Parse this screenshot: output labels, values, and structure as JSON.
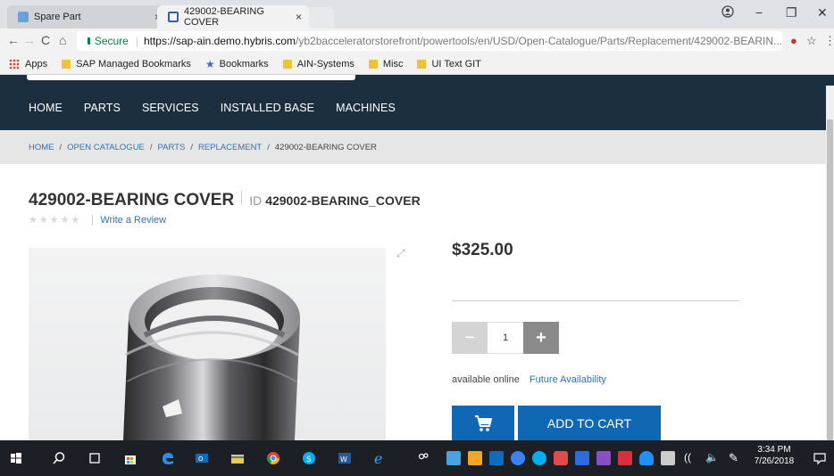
{
  "browser": {
    "tabs": [
      {
        "title": "Spare Part",
        "close": "×"
      },
      {
        "title": "429002-BEARING COVER",
        "close": "×"
      }
    ],
    "window_controls": {
      "minimize": "−",
      "maximize": "❐",
      "close": "✕"
    },
    "nav": {
      "back": "←",
      "forward": "→",
      "reload": "C",
      "home": "⌂"
    },
    "address": {
      "secure_label": "Secure",
      "url_domain": "https://sap-ain.demo.hybris.com",
      "url_path": "/yb2bacceleratorstorefront/powertools/en/USD/Open-Catalogue/Parts/Replacement/429002-BEARIN..."
    },
    "bookmarks": [
      "Apps",
      "SAP Managed Bookmarks",
      "Bookmarks",
      "AIN-Systems",
      "Misc",
      "UI Text GIT"
    ]
  },
  "site": {
    "nav": [
      "HOME",
      "PARTS",
      "SERVICES",
      "INSTALLED BASE",
      "MACHINES"
    ],
    "breadcrumb": {
      "items": [
        "HOME",
        "OPEN CATALOGUE",
        "PARTS",
        "REPLACEMENT"
      ],
      "current": "429002-BEARING COVER",
      "separator": "/"
    },
    "product": {
      "name": "429002-BEARING COVER",
      "id_label": "ID",
      "id_value": "429002-BEARING_COVER",
      "stars": "★★★★★",
      "review_link": "Write a Review",
      "price": "$325.00",
      "qty_minus": "−",
      "qty_value": "1",
      "qty_plus": "+",
      "availability": "available online",
      "future_link": "Future Availability",
      "add_to_cart": "ADD TO CART"
    }
  },
  "taskbar": {
    "time": "3:34 PM",
    "date": "7/26/2018"
  },
  "colors": {
    "nav_bg": "#1c2f3f",
    "link": "#2d72b8",
    "cart_blue": "#1068b5",
    "breadcrumb_bg": "#e6e6e6"
  }
}
